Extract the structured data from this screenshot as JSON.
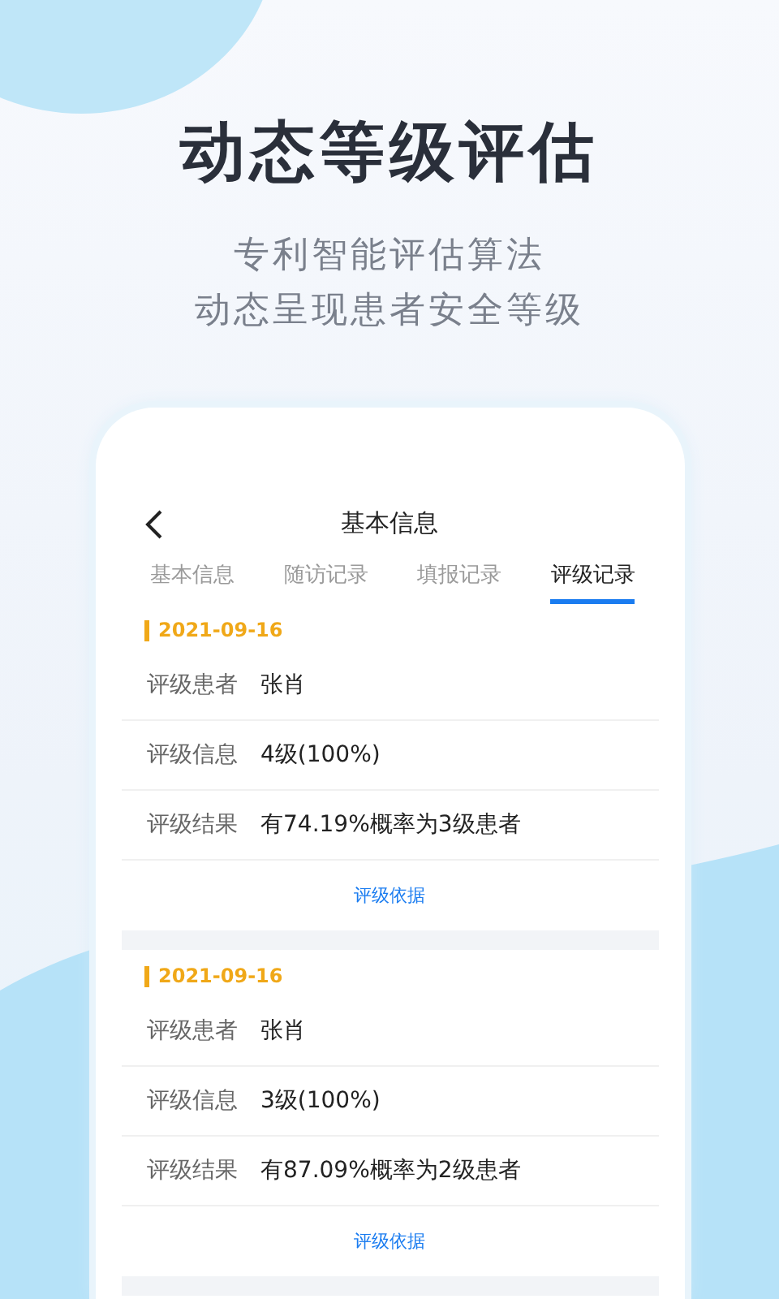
{
  "headline": "动态等级评估",
  "subtitle_lines": [
    "专利智能评估算法",
    "动态呈现患者安全等级"
  ],
  "phone": {
    "nav_title": "基本信息",
    "tabs": [
      {
        "label": "基本信息",
        "selected": false
      },
      {
        "label": "随访记录",
        "selected": false
      },
      {
        "label": "填报记录",
        "selected": false
      },
      {
        "label": "评级记录",
        "selected": true
      }
    ],
    "records": [
      {
        "date": "2021-09-16",
        "rows": [
          {
            "label": "评级患者",
            "value": "张肖"
          },
          {
            "label": "评级信息",
            "value": "4级(100%)"
          },
          {
            "label": "评级结果",
            "value": "有74.19%概率为3级患者"
          }
        ],
        "link": "评级依据"
      },
      {
        "date": "2021-09-16",
        "rows": [
          {
            "label": "评级患者",
            "value": "张肖"
          },
          {
            "label": "评级信息",
            "value": "3级(100%)"
          },
          {
            "label": "评级结果",
            "value": "有87.09%概率为2级患者"
          }
        ],
        "link": "评级依据"
      }
    ]
  }
}
